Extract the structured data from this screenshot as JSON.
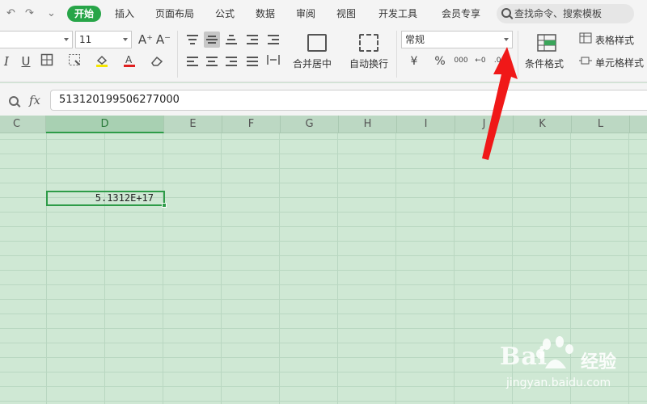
{
  "quick_access": {
    "undo": "↶",
    "redo": "↷",
    "more": "⌄"
  },
  "tabs": [
    "开始",
    "插入",
    "页面布局",
    "公式",
    "数据",
    "审阅",
    "视图",
    "开发工具",
    "会员专享"
  ],
  "active_tab": "开始",
  "search": {
    "label": "查找命令、搜索模板"
  },
  "ribbon": {
    "font_name": "",
    "font_size": "11",
    "grow_font": "A⁺",
    "shrink_font": "A⁻",
    "italic": "I",
    "underline": "U",
    "merge_center": "合并居中",
    "wrap_text": "自动换行",
    "number_format": "常规",
    "currency": "¥",
    "percent": "%",
    "thousands": "000",
    "inc_decimal": "←0",
    "dec_decimal": ".00",
    "cond_format": "条件格式",
    "table_style": "表格样式",
    "cell_style": "单元格样式"
  },
  "formula_bar": {
    "fx": "fx",
    "value": "513120199506277000"
  },
  "columns": [
    "C",
    "D",
    "E",
    "F",
    "G",
    "H",
    "I",
    "J",
    "K",
    "L"
  ],
  "active_column": "D",
  "selected_cell": {
    "display": "5.1312E+17"
  },
  "colors": {
    "accent": "#27a548",
    "sheet_bg": "#cfe8d4",
    "annotation_arrow": "#f01818"
  },
  "watermark": {
    "brand": "Bai",
    "brand_cn": "经验",
    "url": "jingyan.baidu.com"
  }
}
